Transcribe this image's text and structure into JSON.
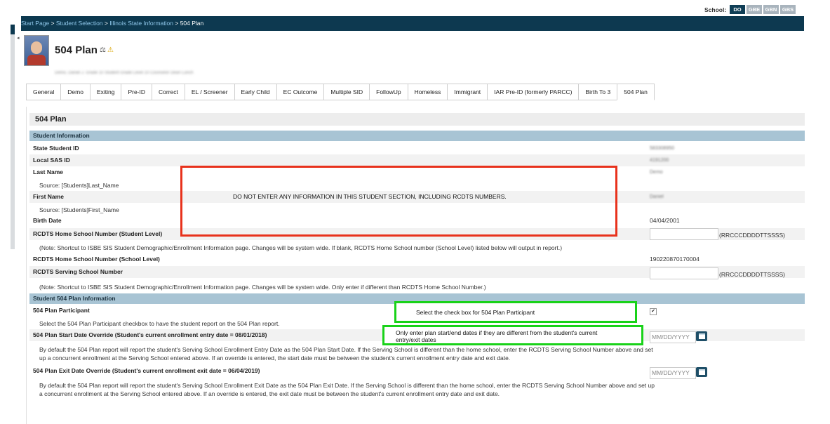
{
  "school": {
    "label": "School:",
    "buttons": [
      "DO",
      "GBE",
      "GBN",
      "GBS"
    ]
  },
  "breadcrumb": {
    "items": [
      "Start Page",
      "Student Selection",
      "Illinois State Information"
    ],
    "current": "504 Plan",
    "separator": ">"
  },
  "page": {
    "title": "504 Plan",
    "info_row": "Demo, Daniel J.   Grade 10   Student Grade Level 10   Counselor   Dean   Lunch"
  },
  "tabs": [
    "General",
    "Demo",
    "Exiting",
    "Pre-ID",
    "Correct",
    "EL / Screener",
    "Early Child",
    "EC Outcome",
    "Multiple SID",
    "FollowUp",
    "Homeless",
    "Immigrant",
    "IAR Pre-ID (formerly PARCC)",
    "Birth To 3",
    "504 Plan"
  ],
  "section_title": "504 Plan",
  "student_info": {
    "header": "Student Information",
    "state_id_label": "State Student ID",
    "state_id_value": "583308950",
    "local_id_label": "Local SAS ID",
    "local_id_value": "4191200",
    "last_name_label": "Last Name",
    "last_name_value": "Demo",
    "last_name_source": "Source: [Students]Last_Name",
    "first_name_label": "First Name",
    "first_name_value": "Daniel",
    "first_name_source": "Source: [Students]First_Name",
    "birth_date_label": "Birth Date",
    "birth_date_value": "04/04/2001",
    "rcdts_home_student_label": "RCDTS Home School Number (Student Level)",
    "rcdts_format": "(RRCCCDDDDTTSSSS)",
    "rcdts_home_note": "(Note: Shortcut to ISBE SIS Student Demographic/Enrollment Information page. Changes will be system wide. If blank, RCDTS Home School number (School Level) listed below will output in report.)",
    "rcdts_home_school_label": "RCDTS Home School Number (School Level)",
    "rcdts_home_school_value": "190220870170004",
    "rcdts_serving_label": "RCDTS Serving School Number",
    "rcdts_serving_note": "(Note: Shortcut to ISBE SIS Student Demographic/Enrollment Information page. Changes will be system wide. Only enter if different than RCDTS Home School Number.)"
  },
  "plan_info": {
    "header": "Student 504 Plan Information",
    "participant_label": "504 Plan Participant",
    "participant_checked": true,
    "participant_note": "Select the 504 Plan Participant checkbox to have the student report on the 504 Plan report.",
    "start_label": "504 Plan Start Date Override (Student's current enrollment entry date = 08/01/2018)",
    "start_placeholder": "MM/DD/YYYY",
    "start_note": "By default the 504 Plan report will report the student's Serving School Enrollment Entry Date as the 504 Plan Start Date. If the Serving School is different than the home school, enter the RCDTS Serving School Number above and set up a concurrent enrollment at the Serving School entered above. If an override is entered, the start date must be between the student's current enrollment entry date and exit date.",
    "exit_label": "504 Plan Exit Date Override (Student's current enrollment exit date = 06/04/2019)",
    "exit_placeholder": "MM/DD/YYYY",
    "exit_note": "By default the 504 Plan report will report the student's Serving School Enrollment Exit Date as the 504 Plan Exit Date. If the Serving School is different than the home school, enter the RCDTS Serving School Number above and set up a concurrent enrollment at the Serving School entered above. If an override is entered, the exit date must be between the student's current enrollment entry date and exit date."
  },
  "annotations": {
    "red_note": "DO NOT ENTER ANY INFORMATION IN THIS STUDENT SECTION, INCLUDING RCDTS NUMBERS.",
    "green_note1": "Select the check box for 504 Plan Participant",
    "green_note2": "Only enter plan start/end dates if they are different from the student's current entry/exit dates"
  },
  "colors": {
    "header_bar": "#0d3950",
    "group_header": "#a8c4d4",
    "red_box": "#e8321c",
    "green_box": "#19d219"
  }
}
